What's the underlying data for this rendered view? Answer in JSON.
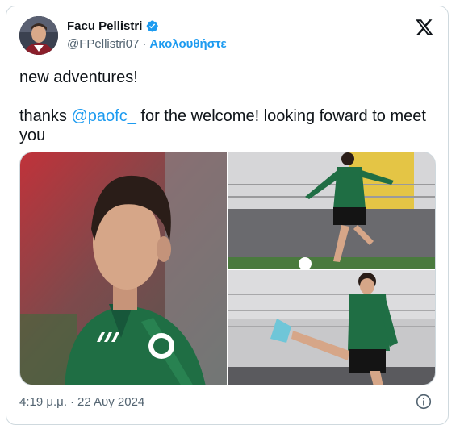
{
  "author": {
    "display_name": "Facu Pellistri",
    "handle": "@FPellistri07",
    "follow_label": "Ακολουθήστε",
    "separator": "·"
  },
  "tweet": {
    "line1": "new adventures!",
    "line2_prefix": "thanks ",
    "mention": "@paofc_",
    "line2_suffix": " for the welcome! looking foward to meet you"
  },
  "footer": {
    "time": "4:19 μ.μ.",
    "separator": "·",
    "date": "22 Αυγ 2024"
  },
  "icons": {
    "verified": "verified-badge-icon",
    "platform": "x-logo-icon",
    "info": "info-icon"
  },
  "colors": {
    "accent": "#1d9bf0",
    "text": "#0f1419",
    "muted": "#536471",
    "border": "#cfd9de",
    "jersey_green": "#1f6e44"
  }
}
